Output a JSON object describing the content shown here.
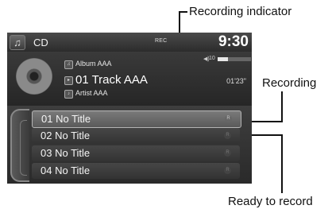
{
  "callouts": {
    "recording_indicator": "Recording indicator",
    "recording": "Recording",
    "ready_to_record": "Ready to record"
  },
  "screen": {
    "source_label": "CD",
    "rec_badge": "REC",
    "clock": "9:30",
    "volume_level": "10",
    "volume_fraction": 0.3,
    "now_playing": {
      "album": "Album AAA",
      "track": "01  Track AAA",
      "artist": "Artist AAA",
      "elapsed": "01'23\""
    },
    "tracks": [
      {
        "label": "01 No Title",
        "flag": "R",
        "selected": true
      },
      {
        "label": "02 No Title",
        "flag": "R"
      },
      {
        "label": "03 No Title",
        "flag": "R"
      },
      {
        "label": "04 No Title",
        "flag": "R"
      }
    ],
    "icons": {
      "source": "music-note-icon",
      "album": "album-icon",
      "track": "track-icon",
      "artist": "artist-icon",
      "volume": "speaker-icon",
      "disc": "disc-icon"
    }
  }
}
